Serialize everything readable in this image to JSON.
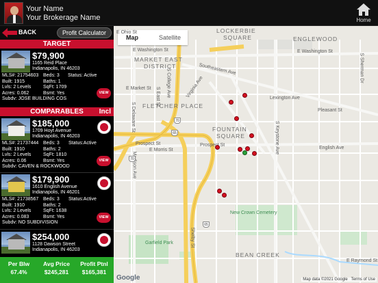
{
  "header": {
    "agent_name": "Your Name",
    "brokerage": "Your Brokerage Name",
    "home_label": "Home"
  },
  "toolbar": {
    "back_label": "BACK",
    "calc_label": "Profit Calculator"
  },
  "target": {
    "section_label": "TARGET",
    "price": "$79,900",
    "address1": "1165 Reid Place",
    "address2": "Indianapolis, IN 46203",
    "mls": "MLS#: 21754603",
    "beds": "Beds: 3",
    "status": "Status: Active",
    "built": "Built: 1915",
    "baths": "Baths: 1",
    "lvls": "Lvls: 2 Levels",
    "sqft": "SqFt: 1709",
    "acres": "Acres: 0.062",
    "bsmt": "Bsmt: Yes",
    "subdv": "Subdv: JOSE BUILDING COS",
    "view_label": "VIEW"
  },
  "comparables": {
    "section_label": "COMPARABLES",
    "incl_label": "Incl",
    "items": [
      {
        "price": "$185,000",
        "address1": "1709 Hoyt Avenue",
        "address2": "Indianapolis, IN 46203",
        "mls": "MLS#: 21737444",
        "beds": "Beds: 3",
        "status": "Status:Active",
        "built": "Built: 1910",
        "baths": "Baths: 2",
        "lvls": "Lvls: 2 Levels",
        "sqft": "SqFt: 1810",
        "acres": "Acres: 0.06",
        "bsmt": "Bsmt: Yes",
        "subdv": "Subdv: CAVEN & ROCKWOOD",
        "view_label": "VIEW"
      },
      {
        "price": "$179,900",
        "address1": "1610 English Avenue",
        "address2": "Indianapolis, IN 46201",
        "mls": "MLS#: 21738567",
        "beds": "Beds: 3",
        "status": "Status:Active",
        "built": "Built: 1910",
        "baths": "Baths: 2",
        "lvls": "Lvls: 2 Levels",
        "sqft": "SqFt: 1638",
        "acres": "Acres: 0.083",
        "bsmt": "Bsmt: Yes",
        "subdv": "Subdv: NO SUBDIVISION",
        "view_label": "VIEW"
      },
      {
        "price": "$254,000",
        "address1": "1128 Dawson Street",
        "address2": "Indianapolis, IN 46203"
      }
    ]
  },
  "summary": {
    "per_blw_label": "Per Blw",
    "per_blw_value": "67.4%",
    "avg_price_label": "Avg Price",
    "avg_price_value": "$245,281",
    "profit_label": "Profit Ptnl",
    "profit_value": "$165,381"
  },
  "map": {
    "tab_map": "Map",
    "tab_satellite": "Satellite",
    "labels": {
      "lockerbie": "LOCKERBIE",
      "square": "SQUARE",
      "englewood": "ENGLEWOOD",
      "market_east": "MARKET EAST",
      "district": "DISTRICT",
      "fletcher": "FLETCHER PLACE",
      "fountain": "FOUNTAIN",
      "fountain_sq": "SQUARE",
      "bean_creek": "BEAN CREEK",
      "new_crown": "New Crown Cemetery",
      "garfield": "Garfield Park",
      "washington": "E Washington St",
      "washington2": "E Washington St",
      "southeastern": "Southeastern Ave",
      "e_ohio": "E Ohio St",
      "e_market": "E Market St",
      "prospect": "Prospect St",
      "prospect2": "Prospect St",
      "e_morris": "E Morris St",
      "sherman": "S Sherman Dr",
      "keystone": "S Keystone Ave",
      "raymond": "E Raymond St",
      "pleasant": "Pleasant St",
      "lexington": "Lexington Ave",
      "college": "S College Ave",
      "virginia": "Virginia Ave",
      "delaware": "S Delaware St",
      "madison": "Madison Ave",
      "shelby": "Shelby St",
      "east_st": "S East St",
      "english": "English Ave"
    },
    "shields": [
      "70",
      "65",
      "65",
      "70"
    ],
    "google_label": "Google",
    "map_data_label": "Map data ©2021 Google",
    "terms_label": "Terms of Use"
  }
}
